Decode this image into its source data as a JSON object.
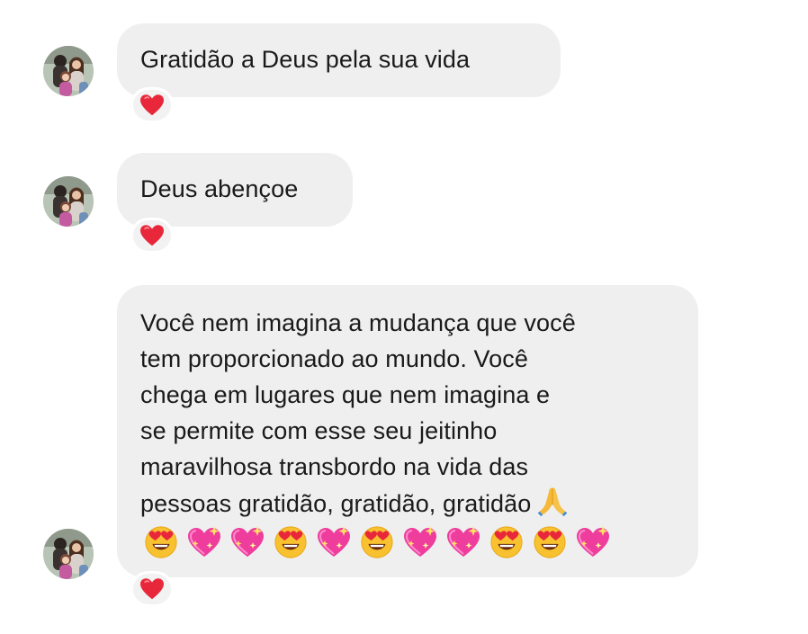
{
  "messages": [
    {
      "lines": [
        "Gratidão a Deus pela sua vida"
      ],
      "reaction": "heart-icon"
    },
    {
      "lines": [
        "Deus abençoe"
      ],
      "reaction": "heart-icon"
    },
    {
      "lines": [
        "Você nem imagina a mudança que você",
        "tem proporcionado ao mundo. Você",
        "chega em lugares que nem imagina e",
        "se permite com esse seu jeitinho",
        "maravilhosa transbordo na vida das",
        "pessoas gratidão, gratidão, gratidão"
      ],
      "trailing_emoji": "folded-hands-icon",
      "emoji_row": [
        "heart-eyes-icon",
        "sparkling-heart-icon",
        "sparkling-heart-icon",
        "heart-eyes-icon",
        "sparkling-heart-icon",
        "heart-eyes-icon",
        "sparkling-heart-icon",
        "sparkling-heart-icon",
        "heart-eyes-icon",
        "heart-eyes-icon",
        "sparkling-heart-icon"
      ],
      "reaction": "heart-icon"
    }
  ],
  "colors": {
    "bubble": "#efefef",
    "heart": "#e8283a",
    "emoji_face": "#f8c12f",
    "emoji_heart": "#ee3d9c"
  }
}
